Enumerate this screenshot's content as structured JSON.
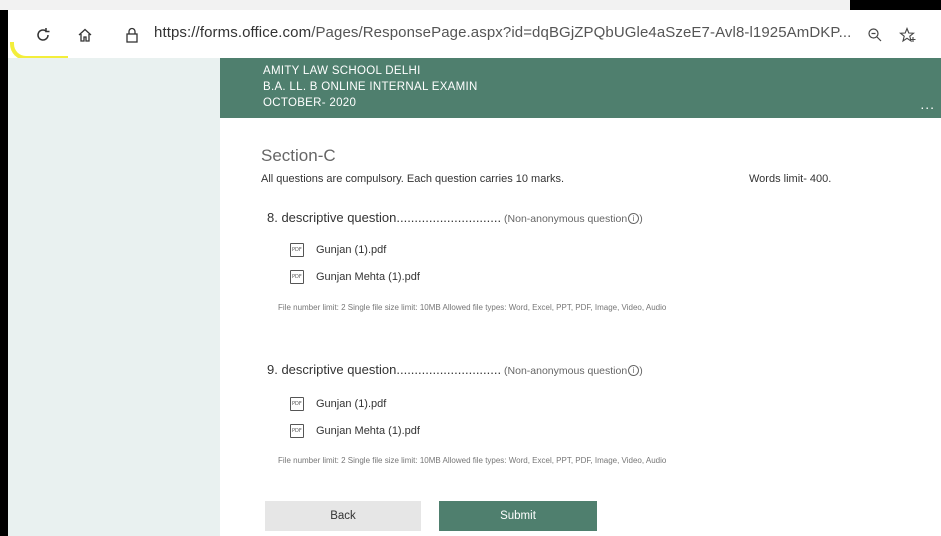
{
  "browser": {
    "url_prefix": "https://",
    "url_domain": "forms.office.com",
    "url_path": "/Pages/ResponsePage.aspx?id=dqBGjZPQbUGle4aSzeE7-Avl8-l1925AmDKP...",
    "icons": [
      "refresh-icon",
      "home-icon",
      "lock-icon",
      "zoom-icon",
      "favorite-star-icon"
    ]
  },
  "header": {
    "line1": "AMITY LAW SCHOOL DELHI",
    "line2": "B.A. LL. B ONLINE INTERNAL EXAMIN",
    "line3": "OCTOBER- 2020",
    "more": "..."
  },
  "section": {
    "title": "Section-C",
    "instructions": "All questions are compulsory. Each question carries 10 marks.",
    "words_limit": "Words limit- 400."
  },
  "questions": [
    {
      "label": "8. descriptive question.............................",
      "meta": " (Non-anonymous question",
      "info": "i",
      "meta_end": ")",
      "files": [
        "Gunjan (1).pdf",
        "Gunjan Mehta (1).pdf"
      ],
      "limits": "File number limit: 2   Single file size limit: 10MB   Allowed file types: Word, Excel, PPT, PDF, Image, Video, Audio"
    },
    {
      "label": "9. descriptive question.............................",
      "meta": " (Non-anonymous question",
      "info": "i",
      "meta_end": ")",
      "files": [
        "Gunjan (1).pdf",
        "Gunjan Mehta (1).pdf"
      ],
      "limits": "File number limit: 2   Single file size limit: 10MB   Allowed file types: Word, Excel, PPT, PDF, Image, Video, Audio"
    }
  ],
  "buttons": {
    "back": "Back",
    "submit": "Submit"
  },
  "colors": {
    "accent": "#4f7f6e",
    "page_bg": "#e9f1f0",
    "highlight": "#f3ee3b"
  }
}
